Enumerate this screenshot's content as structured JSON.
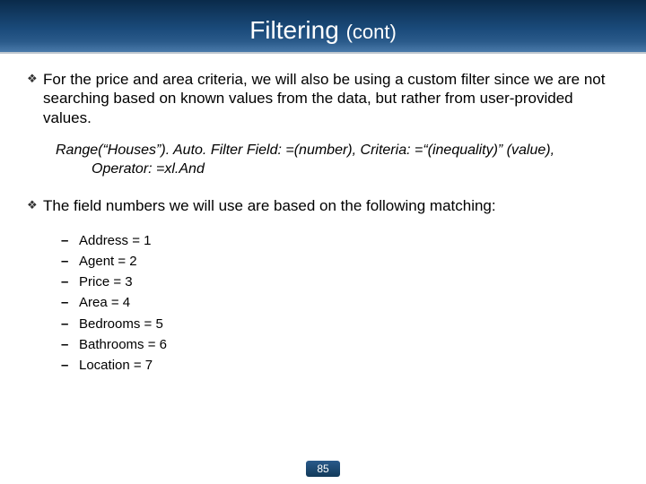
{
  "title": {
    "main": "Filtering ",
    "sub": "(cont)"
  },
  "bullets": [
    "For the price and area criteria, we will also be using a custom filter since we are not searching based on known values from the data, but rather from user-provided values.",
    "The field numbers we will use are based on the following matching:"
  ],
  "code": {
    "line1": "Range(“Houses”). Auto. Filter Field: =(number), Criteria: =“(inequality)” (value),",
    "line2": "Operator: =xl.And"
  },
  "fields": [
    "Address = 1",
    "Agent = 2",
    "Price = 3",
    "Area = 4",
    "Bedrooms = 5",
    "Bathrooms = 6",
    "Location = 7"
  ],
  "page": "85",
  "glyphs": {
    "diamond": "❖",
    "dash": "–"
  }
}
